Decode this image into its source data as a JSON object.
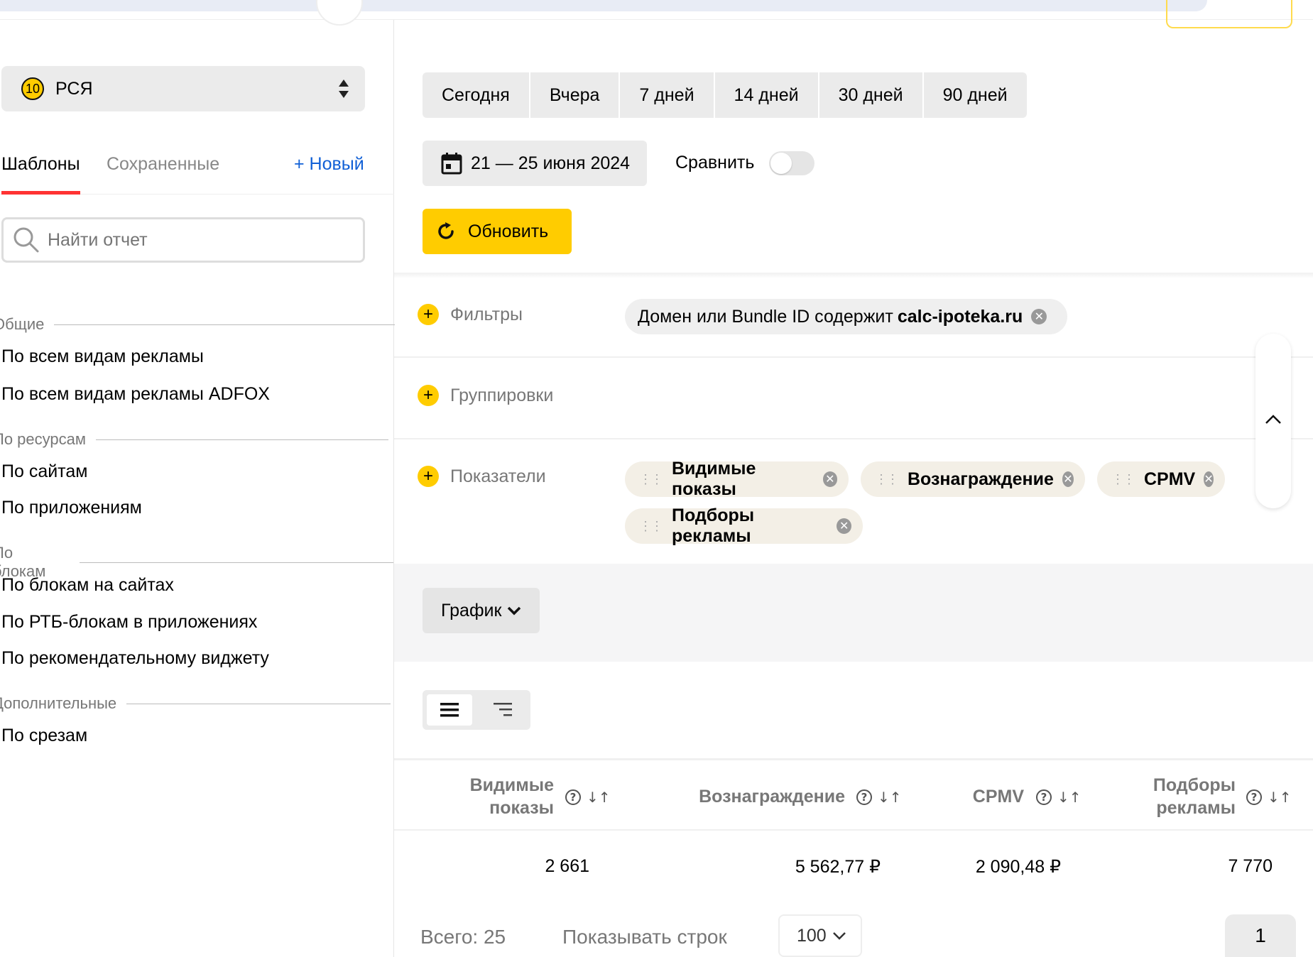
{
  "sidebar": {
    "source": {
      "badge": "10",
      "label": "РСЯ"
    },
    "tabs": {
      "templates": "Шаблоны",
      "saved": "Сохраненные",
      "new": "+ Новый"
    },
    "search_placeholder": "Найти отчет",
    "sections": [
      {
        "title": "Общие",
        "items": [
          "По всем видам рекламы",
          "По всем видам рекламы ADFOX"
        ]
      },
      {
        "title": "По ресурсам",
        "items": [
          "По сайтам",
          "По приложениям"
        ]
      },
      {
        "title": "По блокам",
        "items": [
          "По блокам на сайтах",
          "По РТБ-блокам в приложениях",
          "По рекомендательному виджету"
        ]
      },
      {
        "title": "Дополнительные",
        "items": [
          "По срезам"
        ]
      }
    ]
  },
  "periods": [
    "Сегодня",
    "Вчера",
    "7 дней",
    "14 дней",
    "30 дней",
    "90 дней"
  ],
  "date_range": "21 — 25 июня 2024",
  "compare_label": "Сравнить",
  "compare_on": false,
  "refresh_label": "Обновить",
  "filters": {
    "label": "Фильтры",
    "chip_prefix": "Домен или Bundle ID содержит ",
    "chip_value": "calc-ipoteka.ru"
  },
  "groupings": {
    "label": "Группировки"
  },
  "metrics": {
    "label": "Показатели",
    "chips": [
      "Видимые показы",
      "Вознаграждение",
      "CPMV",
      "Подборы рекламы"
    ]
  },
  "graph_label": "График",
  "table": {
    "headers": [
      {
        "line1": "Видимые",
        "line2": "показы"
      },
      {
        "line1": "Вознаграждение",
        "line2": ""
      },
      {
        "line1": "CPMV",
        "line2": ""
      },
      {
        "line1": "Подборы",
        "line2": "рекламы"
      }
    ],
    "row": [
      "2 661",
      "5 562,77 ₽",
      "2 090,48 ₽",
      "7 770"
    ]
  },
  "footer": {
    "total": "Всего: 25",
    "rows_label": "Показывать строк",
    "rows_value": "100",
    "page": "1"
  },
  "colors": {
    "accent": "#ffcc00",
    "tab_underline": "#ff3333",
    "link": "#1160d6"
  }
}
